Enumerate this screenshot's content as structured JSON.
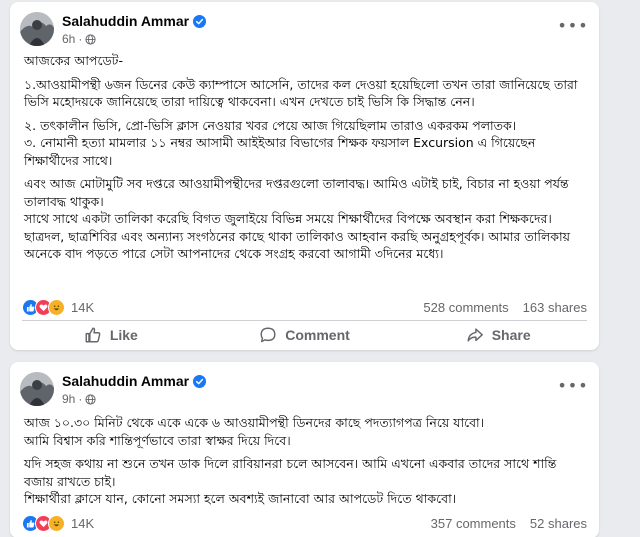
{
  "colors": {
    "background": "#e9ebee",
    "card": "#ffffff",
    "text": "#050505",
    "secondary_text": "#65676b",
    "verified_blue": "#1877f2",
    "like_blue": "#1877f2",
    "love_red": "#f33e58",
    "haha_yellow": "#f7b125"
  },
  "posts": [
    {
      "author": "Salahuddin Ammar",
      "time": "6h",
      "audience_icon": "globe-icon",
      "paragraphs": [
        "আজকের আপডেট-",
        "১.আওয়ামীপন্থী ৬জন ডিনের কেউ ক্যাম্পাসে আসেনি, তাদের কল দেওয়া হয়েছিলো তখন তারা জানিয়েছে তারা ভিসি মহোদয়কে জানিয়েছে তারা দায়িত্বে থাকবেনা। এখন দেখতে চাই ভিসি কি সিদ্ধান্ত নেন।",
        "২. তৎকালীন ভিসি, প্রো-ভিসি ক্লাস নেওয়ার খবর পেয়ে আজ গিয়েছিলাম তারাও একরকম পলাতক।",
        "৩. নোমানী হত্যা মামলার ১১ নম্বর আসামী আইইআর বিভাগের শিক্ষক ফয়সাল Excursion এ গিয়েছেন শিক্ষার্থীদের সাথে।",
        "এবং আজ মোটামুটি সব দপ্তরে আওয়ামীপন্থীদের দপ্তরগুলো তালাবদ্ধ। আমিও এটাই চাই, বিচার না হওয়া পর্যন্ত তালাবদ্ধ থাকুক।",
        "সাথে সাথে একটা তালিকা করেছি বিগত জুলাইয়ে বিভিন্ন সময়ে শিক্ষার্থীদের বিপক্ষে অবস্থান করা শিক্ষকদের।",
        "ছাত্রদল, ছাত্রশিবির এবং অন্যান্য সংগঠনের কাছে থাকা তালিকাও আহবান করছি অনুগ্রহপূর্বক। আমার তালিকায় অনেকে বাদ পড়তে পারে সেটা আপনাদের থেকে সংগ্রহ করবো আগামী ৩দিনের মধ্যে।"
      ],
      "reactions_count": "14K",
      "comments": "528 comments",
      "shares": "163 shares",
      "actions": {
        "like": "Like",
        "comment": "Comment",
        "share": "Share"
      }
    },
    {
      "author": "Salahuddin Ammar",
      "time": "9h",
      "audience_icon": "globe-icon",
      "paragraphs": [
        "আজ ১০.৩০ মিনিট থেকে একে একে ৬ আওয়ামীপন্থী ডিনদের কাছে পদত্যাগপত্র নিয়ে যাবো।",
        "আমি বিশ্বাস করি শান্তিপূর্ণভাবে তারা স্বাক্ষর দিয়ে দিবে।",
        "যদি সহজ কথায় না শুনে তখন ডাক দিলে রাবিয়ানরা চলে আসবেন। আমি এখনো একবার তাদের সাথে শান্তি বজায় রাখতে চাই।",
        "শিক্ষার্থীরা ক্লাসে যান, কোনো সমস্যা হলে অবশ্যই জানাবো আর আপডেট দিতে থাকবো।"
      ],
      "reactions_count": "14K",
      "comments": "357 comments",
      "shares": "52 shares"
    }
  ]
}
